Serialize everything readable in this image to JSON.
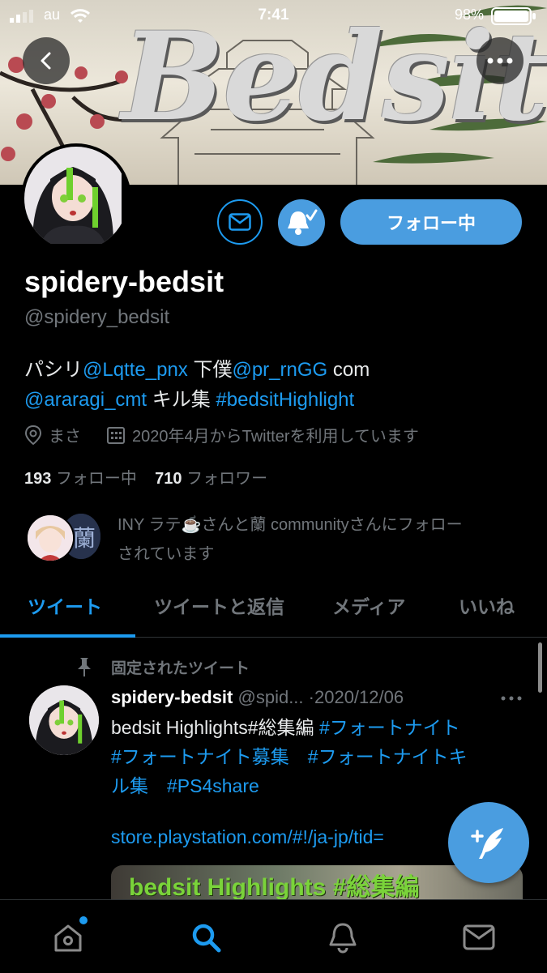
{
  "status_bar": {
    "carrier": "au",
    "time": "7:41",
    "battery": "98%"
  },
  "header": {
    "banner_text": "Bedsit"
  },
  "profile": {
    "display_name": "spidery-bedsit",
    "handle": "@spidery_bedsit",
    "follow_button": "フォロー中",
    "bio": {
      "p1": "パシリ",
      "m1": "@Lqtte_pnx",
      "p2": " 下僕",
      "m2": "@pr_rnGG",
      "p3": " com",
      "m3": "@araragi_cmt",
      "p4": " キル集 ",
      "h1": "#bedsitHighlight"
    },
    "location": "まさ",
    "joined": "2020年4月からTwitterを利用しています",
    "following_count": "193",
    "following_label": "フォロー中",
    "followers_count": "710",
    "followers_label": "フォロワー",
    "followed_by_l1": "INY ラテ☕️さんと蘭 communityさんにフォロー",
    "followed_by_l2": "されています"
  },
  "tabs": [
    {
      "label": "ツイート",
      "active": true
    },
    {
      "label": "ツイートと返信",
      "active": false
    },
    {
      "label": "メディア",
      "active": false
    },
    {
      "label": "いいね",
      "active": false
    }
  ],
  "tweet": {
    "pinned_label": "固定されたツイート",
    "author_name": "spidery-bedsit",
    "author_handle": "@spid...",
    "date": "·2020/12/06",
    "text": "bedsit Highlights#総集編",
    "tags_l1": " #フォートナイト",
    "tags_l2": "#フォートナイト募集　#フォートナイトキ",
    "tags_l3": "ル集　#PS4share",
    "url": "store.playstation.com/#!/ja-jp/tid=",
    "media_text": "bedsit Highlights #総集編"
  },
  "colors": {
    "accent": "#1d9bf0",
    "follow_button": "#4a9de0",
    "background": "#000000",
    "secondary_text": "#71767b"
  }
}
